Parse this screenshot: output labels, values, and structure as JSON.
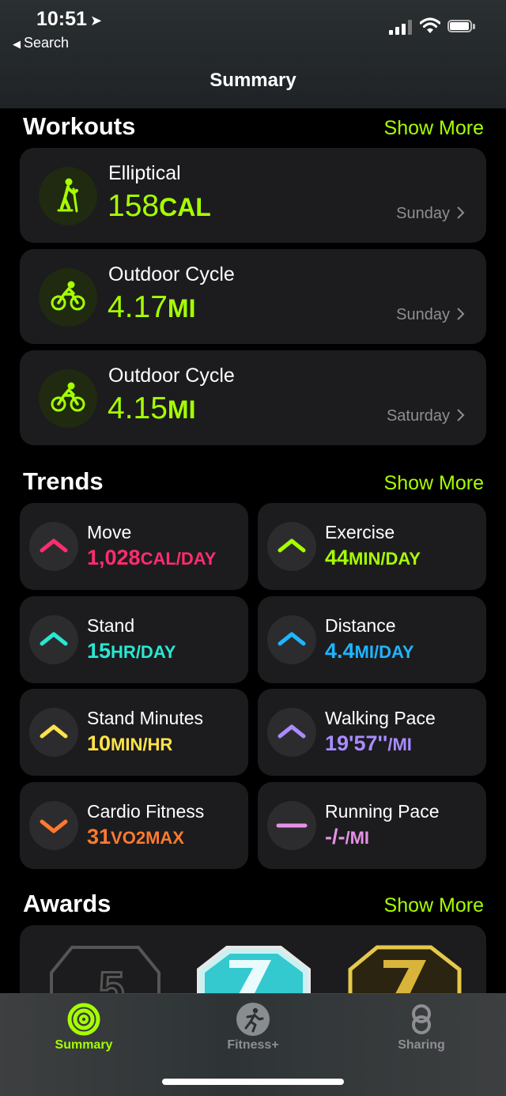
{
  "status_bar": {
    "time": "10:51",
    "back_label": "Search"
  },
  "nav": {
    "title": "Summary"
  },
  "colors": {
    "accent": "#a6ff00",
    "move": "#ff2d6f",
    "exercise": "#a6ff00",
    "stand": "#2ae6d2",
    "distance": "#1fb5ff",
    "stand_minutes": "#ffe24a",
    "walking_pace": "#a98cff",
    "cardio": "#ff7a2e",
    "running_pace": "#e591e6"
  },
  "workouts": {
    "title": "Workouts",
    "show_more": "Show More",
    "items": [
      {
        "name": "Elliptical",
        "value": "158",
        "unit": "CAL",
        "day": "Sunday",
        "icon": "elliptical-icon"
      },
      {
        "name": "Outdoor Cycle",
        "value": "4.17",
        "unit": "MI",
        "day": "Sunday",
        "icon": "cycle-icon"
      },
      {
        "name": "Outdoor Cycle",
        "value": "4.15",
        "unit": "MI",
        "day": "Saturday",
        "icon": "cycle-icon"
      }
    ]
  },
  "trends": {
    "title": "Trends",
    "show_more": "Show More",
    "items": [
      {
        "name": "Move",
        "value": "1,028",
        "unit": "CAL/DAY",
        "direction": "up",
        "color": "#ff2d6f"
      },
      {
        "name": "Exercise",
        "value": "44",
        "unit": "MIN/DAY",
        "direction": "up",
        "color": "#a6ff00"
      },
      {
        "name": "Stand",
        "value": "15",
        "unit": "HR/DAY",
        "direction": "up",
        "color": "#2ae6d2"
      },
      {
        "name": "Distance",
        "value": "4.4",
        "unit": "MI/DAY",
        "direction": "up",
        "color": "#1fb5ff"
      },
      {
        "name": "Stand Minutes",
        "value": "10",
        "unit": "MIN/HR",
        "direction": "up",
        "color": "#ffe24a"
      },
      {
        "name": "Walking Pace",
        "value": "19'57''",
        "unit": "/MI",
        "direction": "up",
        "color": "#a98cff"
      },
      {
        "name": "Cardio Fitness",
        "value": "31",
        "unit": "VO2MAX",
        "direction": "down",
        "color": "#ff7a2e"
      },
      {
        "name": "Running Pace",
        "value": "-/-",
        "unit": "/MI",
        "direction": "flat",
        "color": "#e591e6"
      }
    ]
  },
  "awards": {
    "title": "Awards",
    "show_more": "Show More",
    "badge_icons": [
      "award-5-badge-icon",
      "award-7-teal-badge-icon",
      "award-7-gold-badge-icon"
    ]
  },
  "tabbar": {
    "items": [
      {
        "label": "Summary",
        "icon": "activity-rings-icon",
        "active": true
      },
      {
        "label": "Fitness+",
        "icon": "runner-icon",
        "active": false
      },
      {
        "label": "Sharing",
        "icon": "sharing-icon",
        "active": false
      }
    ]
  }
}
